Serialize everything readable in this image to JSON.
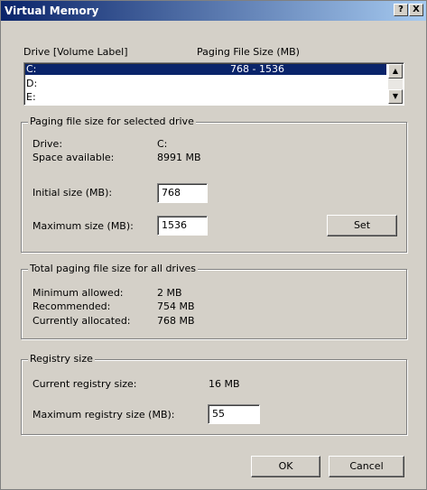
{
  "window": {
    "title": "Virtual Memory",
    "help_label": "?",
    "close_label": "X"
  },
  "drives": {
    "header_drive": "Drive  [Volume Label]",
    "header_paging": "Paging File Size (MB)",
    "items": [
      {
        "drive": "C:",
        "size": "768 - 1536",
        "selected": true
      },
      {
        "drive": "D:",
        "size": ""
      },
      {
        "drive": "E:",
        "size": ""
      }
    ]
  },
  "selected_drive": {
    "group_label": "Paging file size for selected drive",
    "drive_label": "Drive:",
    "drive_value": "C:",
    "space_label": "Space available:",
    "space_value": "8991 MB",
    "initial_label": "Initial size (MB):",
    "initial_value": "768",
    "maximum_label": "Maximum size (MB):",
    "maximum_value": "1536",
    "set_label": "Set"
  },
  "total": {
    "group_label": "Total paging file size for all drives",
    "min_label": "Minimum allowed:",
    "min_value": "2 MB",
    "rec_label": "Recommended:",
    "rec_value": "754 MB",
    "cur_label": "Currently allocated:",
    "cur_value": "768 MB"
  },
  "registry": {
    "group_label": "Registry size",
    "current_label": "Current registry size:",
    "current_value": "16 MB",
    "max_label": "Maximum registry size (MB):",
    "max_value": "55"
  },
  "buttons": {
    "ok": "OK",
    "cancel": "Cancel"
  }
}
